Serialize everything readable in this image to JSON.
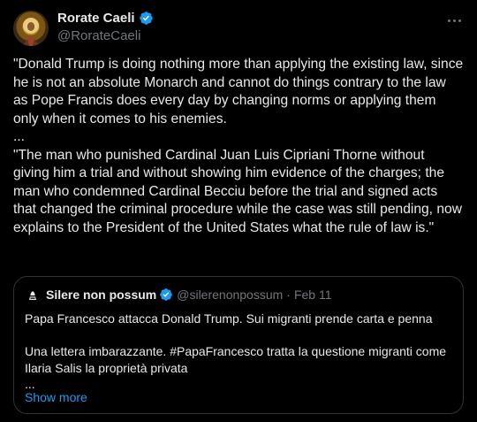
{
  "tweet": {
    "author_name": "Rorate Caeli",
    "author_handle": "@RorateCaeli",
    "text": "\"Donald Trump is doing nothing more than applying the existing law, since he is not an absolute Monarch and cannot do things contrary to the law as Pope Francis does every day by changing norms or applying them only when it comes to his enemies.\n...\n\"The man who punished Cardinal Juan Luis Cipriani Thorne without giving him a trial and without showing him evidence of the charges; the man who condemned Cardinal Becciu before the trial and signed acts that changed the criminal procedure while the case was still pending, now explains to the President of the United States what the rule of law is.\""
  },
  "quote": {
    "author_name": "Silere non possum",
    "author_handle": "@silerenonpossum",
    "separator": "·",
    "date": "Feb 11",
    "text": "Papa Francesco attacca Donald Trump. Sui migranti prende carta e penna\n\nUna lettera imbarazzante. #PapaFrancesco tratta la questione migranti come Ilaria Salis la proprietà privata\n...",
    "show_more": "Show more"
  },
  "icons": {
    "verified": "verified-badge-icon",
    "more": "more-options-icon"
  },
  "colors": {
    "background": "#000000",
    "text": "#e7e9ea",
    "secondary": "#71767b",
    "link": "#1d9bf0",
    "border": "#2f3336"
  }
}
